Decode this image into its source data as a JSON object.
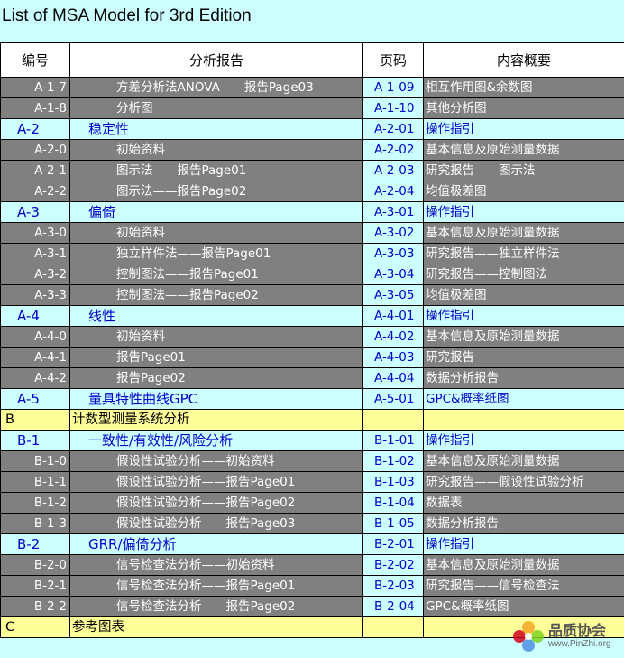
{
  "title": "List of MSA Model for 3rd Edition",
  "headers": [
    "编号",
    "分析报告",
    "页码",
    "内容概要"
  ],
  "rows": [
    {
      "type": "sub",
      "code": "A-1-7",
      "report": "方差分析法ANOVA——报告Page03",
      "page": "A-1-09",
      "summary": "相互作用图&余数图"
    },
    {
      "type": "sub",
      "code": "A-1-8",
      "report": "分析图",
      "page": "A-1-10",
      "summary": "其他分析图"
    },
    {
      "type": "sec",
      "code": "A-2",
      "report": "稳定性",
      "page": "A-2-01",
      "summary": "操作指引"
    },
    {
      "type": "sub",
      "code": "A-2-0",
      "report": "初始资料",
      "page": "A-2-02",
      "summary": "基本信息及原始测量数据"
    },
    {
      "type": "sub",
      "code": "A-2-1",
      "report": "图示法——报告Page01",
      "page": "A-2-03",
      "summary": "研究报告——图示法"
    },
    {
      "type": "sub",
      "code": "A-2-2",
      "report": "图示法——报告Page02",
      "page": "A-2-04",
      "summary": "均值极差图"
    },
    {
      "type": "sec",
      "code": "A-3",
      "report": "偏倚",
      "page": "A-3-01",
      "summary": "操作指引"
    },
    {
      "type": "sub",
      "code": "A-3-0",
      "report": "初始资料",
      "page": "A-3-02",
      "summary": "基本信息及原始测量数据"
    },
    {
      "type": "sub",
      "code": "A-3-1",
      "report": "独立样件法——报告Page01",
      "page": "A-3-03",
      "summary": "研究报告——独立样件法"
    },
    {
      "type": "sub",
      "code": "A-3-2",
      "report": "控制图法——报告Page01",
      "page": "A-3-04",
      "summary": "研究报告——控制图法"
    },
    {
      "type": "sub",
      "code": "A-3-3",
      "report": "控制图法——报告Page02",
      "page": "A-3-05",
      "summary": "均值极差图"
    },
    {
      "type": "sec",
      "code": "A-4",
      "report": "线性",
      "page": "A-4-01",
      "summary": "操作指引"
    },
    {
      "type": "sub",
      "code": "A-4-0",
      "report": "初始资料",
      "page": "A-4-02",
      "summary": "基本信息及原始测量数据"
    },
    {
      "type": "sub",
      "code": "A-4-1",
      "report": "报告Page01",
      "page": "A-4-03",
      "summary": "研究报告"
    },
    {
      "type": "sub",
      "code": "A-4-2",
      "report": "报告Page02",
      "page": "A-4-04",
      "summary": "数据分析报告"
    },
    {
      "type": "sec",
      "code": "A-5",
      "report": "量具特性曲线GPC",
      "page": "A-5-01",
      "summary": "GPC&概率纸图"
    },
    {
      "type": "top",
      "code": "B",
      "report": "计数型测量系统分析",
      "page": "",
      "summary": ""
    },
    {
      "type": "sec",
      "code": "B-1",
      "report": "一致性/有效性/风险分析",
      "page": "B-1-01",
      "summary": "操作指引"
    },
    {
      "type": "sub",
      "code": "B-1-0",
      "report": "假设性试验分析——初始资料",
      "page": "B-1-02",
      "summary": "基本信息及原始测量数据"
    },
    {
      "type": "sub",
      "code": "B-1-1",
      "report": "假设性试验分析——报告Page01",
      "page": "B-1-03",
      "summary": "研究报告——假设性试验分析"
    },
    {
      "type": "sub",
      "code": "B-1-2",
      "report": "假设性试验分析——报告Page02",
      "page": "B-1-04",
      "summary": "数据表"
    },
    {
      "type": "sub",
      "code": "B-1-3",
      "report": "假设性试验分析——报告Page03",
      "page": "B-1-05",
      "summary": "数据分析报告"
    },
    {
      "type": "sec",
      "code": "B-2",
      "report": "GRR/偏倚分析",
      "page": "B-2-01",
      "summary": "操作指引"
    },
    {
      "type": "sub",
      "code": "B-2-0",
      "report": "信号检查法分析——初始资料",
      "page": "B-2-02",
      "summary": "基本信息及原始测量数据"
    },
    {
      "type": "sub",
      "code": "B-2-1",
      "report": "信号检查法分析——报告Page01",
      "page": "B-2-03",
      "summary": "研究报告——信号检查法"
    },
    {
      "type": "sub",
      "code": "B-2-2",
      "report": "信号检查法分析——报告Page02",
      "page": "B-2-04",
      "summary": "GPC&概率纸图"
    },
    {
      "type": "top",
      "code": "C",
      "report": "参考图表",
      "page": "",
      "summary": ""
    }
  ],
  "watermark": {
    "name": "品质协会",
    "url": "www.PinZhi.org"
  }
}
